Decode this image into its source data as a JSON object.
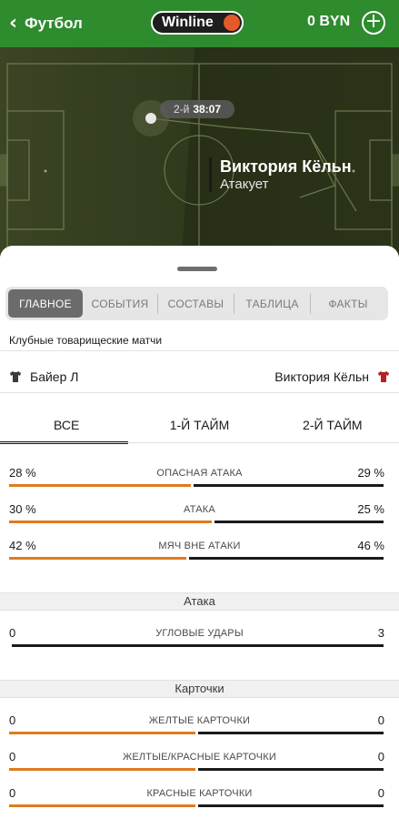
{
  "header": {
    "back_label": "Футбол",
    "brand": "Winline",
    "balance": "0 BYN",
    "add_label": "+"
  },
  "field": {
    "period": "2-й",
    "clock": "38:07",
    "attacking_team": "Виктория Кёльн",
    "attacking_status": "Атакует"
  },
  "tabs": [
    {
      "label": "ГЛАВНОЕ",
      "active": true
    },
    {
      "label": "СОБЫТИЯ",
      "active": false
    },
    {
      "label": "СОСТАВЫ",
      "active": false
    },
    {
      "label": "ТАБЛИЦА",
      "active": false
    },
    {
      "label": "ФАКТЫ",
      "active": false
    }
  ],
  "league": "Клубные товарищеские матчи",
  "teams": {
    "home": "Байер Л",
    "away": "Виктория Кёльн",
    "home_color": "#3a3a3a",
    "away_color": "#b52121"
  },
  "period_tabs": [
    {
      "label": "ВСЕ",
      "active": true
    },
    {
      "label": "1-Й ТАЙМ",
      "active": false
    },
    {
      "label": "2-Й ТАЙМ",
      "active": false
    }
  ],
  "stats_main": [
    {
      "name": "ОПАСНАЯ АТАКА",
      "home": "28 %",
      "away": "29 %",
      "home_share": 0.49
    },
    {
      "name": "АТАКА",
      "home": "30 %",
      "away": "25 %",
      "home_share": 0.545
    },
    {
      "name": "МЯЧ ВНЕ АТАКИ",
      "home": "42 %",
      "away": "46 %",
      "home_share": 0.477
    }
  ],
  "sections": {
    "attack": "Атака",
    "cards": "Карточки"
  },
  "stats_attack": [
    {
      "name": "УГЛОВЫЕ УДАРЫ",
      "home": "0",
      "away": "3",
      "home_share": 0.0
    }
  ],
  "stats_cards": [
    {
      "name": "ЖЕЛТЫЕ КАРТОЧКИ",
      "home": "0",
      "away": "0",
      "home_share": 0.5
    },
    {
      "name": "ЖЕЛТЫЕ/КРАСНЫЕ КАРТОЧКИ",
      "home": "0",
      "away": "0",
      "home_share": 0.5
    },
    {
      "name": "КРАСНЫЕ КАРТОЧКИ",
      "home": "0",
      "away": "0",
      "home_share": 0.5
    }
  ],
  "colors": {
    "header_green": "#2e8b2e",
    "home_bar": "#e07b1c",
    "away_bar": "#1a1a1a"
  }
}
